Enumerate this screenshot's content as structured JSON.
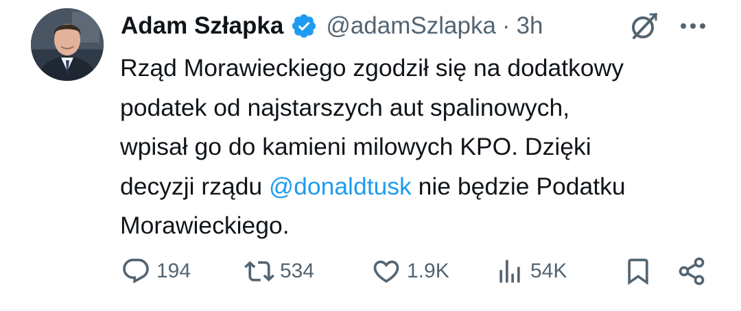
{
  "author": {
    "display_name": "Adam Szłapka",
    "handle": "@adamSzlapka",
    "separator": "·",
    "time": "3h",
    "verified": true,
    "verified_color": "#1d9bf0",
    "avatar_icon": "avatar-photo"
  },
  "tweet": {
    "lines": {
      "l1": "Rząd Morawieckiego zgodził się na dodatkowy",
      "l2": "podatek od najstarszych aut spalinowych,",
      "l3": "wpisał go do kamieni milowych KPO. Dzięki",
      "l4_before": "decyzji rządu ",
      "l4_mention": "@donaldtusk",
      "l4_after": " nie będzie Podatku",
      "l5": "Morawieckiego."
    },
    "mention_color": "#1d9bf0"
  },
  "header_icons": {
    "grok": "grok-icon",
    "more": "more-icon"
  },
  "actions": {
    "reply": {
      "icon": "reply-icon",
      "count": "194"
    },
    "repost": {
      "icon": "repost-icon",
      "count": "534"
    },
    "like": {
      "icon": "heart-icon",
      "count": "1.9K"
    },
    "views": {
      "icon": "views-icon",
      "count": "54K"
    },
    "bookmark": {
      "icon": "bookmark-icon"
    },
    "share": {
      "icon": "share-icon"
    }
  },
  "colors": {
    "text": "#0f1419",
    "secondary": "#536471",
    "accent": "#1d9bf0"
  }
}
